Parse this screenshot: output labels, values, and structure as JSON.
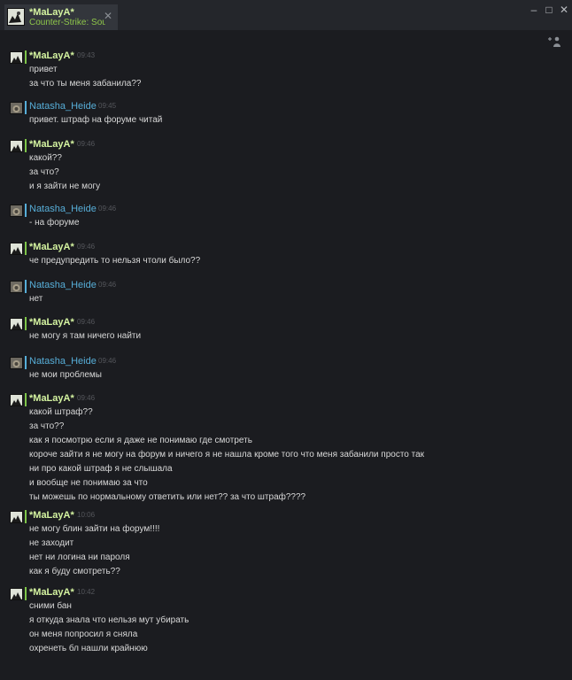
{
  "window": {
    "tab": {
      "name": "*MaLayA*",
      "game": "Counter-Strike: Source",
      "close_icon": "close-icon"
    },
    "controls": {
      "minimize": "–",
      "maximize": "□",
      "close": "✕"
    }
  },
  "chat": {
    "tool_icon": "voice-settings-icon",
    "messages": [
      {
        "sender": "*MaLayA*",
        "time": "09:43",
        "lines": [
          "привет",
          "за что ты меня забанила??"
        ]
      },
      {
        "sender": "Natasha_Heide",
        "time": "09:45",
        "lines": [
          "привет. штраф на форуме читай"
        ]
      },
      {
        "sender": "*MaLayA*",
        "time": "09:46",
        "lines": [
          "какой??",
          "за что?",
          "и я зайти не могу"
        ]
      },
      {
        "sender": "Natasha_Heide",
        "time": "09:46",
        "lines": [
          "- на форуме"
        ]
      },
      {
        "sender": "*MaLayA*",
        "time": "09:46",
        "lines": [
          "че предупредить то нельзя чтоли было??"
        ]
      },
      {
        "sender": "Natasha_Heide",
        "time": "09:46",
        "lines": [
          "нет"
        ]
      },
      {
        "sender": "*MaLayA*",
        "time": "09:46",
        "lines": [
          "не могу я там ничего найти"
        ]
      },
      {
        "sender": "Natasha_Heide",
        "time": "09:46",
        "lines": [
          "не мои проблемы"
        ]
      },
      {
        "sender": "*MaLayA*",
        "time": "09:46",
        "lines": [
          "какой штраф??",
          "за что??",
          "как я посмотрю если я даже не понимаю где смотреть",
          "короче зайти я не могу на форум и ничего я не нашла кроме того что меня забанили просто так",
          "ни про какой штраф я не слышала",
          "и вообще не понимаю за что",
          "ты можешь по нормальному ответить или нет?? за что штраф????"
        ]
      },
      {
        "sender": "*MaLayA*",
        "time": "10:06",
        "lines": [
          "не могу блин зайти на форум!!!!",
          "не заходит",
          "нет ни логина ни пароля",
          "как я буду смотреть??"
        ]
      },
      {
        "sender": "*MaLayA*",
        "time": "10:42",
        "lines": [
          "сними бан",
          "я откуда знала что нельзя мут убирать",
          "он меня попросил я сняла",
          "охренеть бл нашли крайнюю"
        ]
      }
    ]
  }
}
